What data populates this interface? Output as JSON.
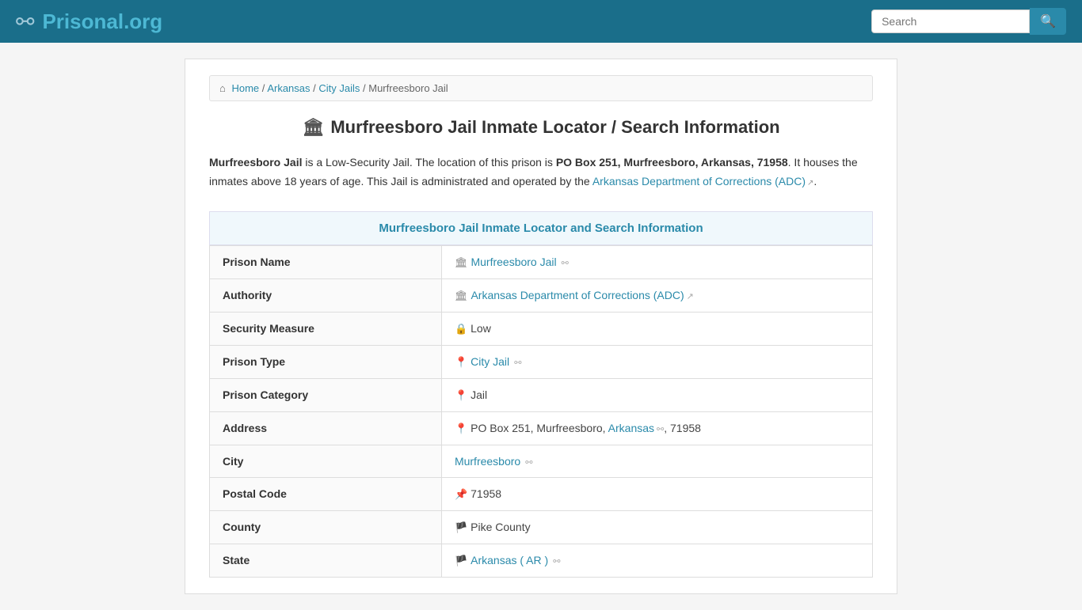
{
  "header": {
    "logo_text": "Prisonal",
    "logo_tld": ".org",
    "search_placeholder": "Search"
  },
  "breadcrumb": {
    "items": [
      {
        "label": "Home",
        "href": "#",
        "icon": "home"
      },
      {
        "label": "Arkansas",
        "href": "#"
      },
      {
        "label": "City Jails",
        "href": "#"
      },
      {
        "label": "Murfreesboro Jail",
        "href": null
      }
    ]
  },
  "page": {
    "title": "Murfreesboro Jail Inmate Locator / Search Information",
    "description_parts": {
      "jail_name": "Murfreesboro Jail",
      "intro": " is a Low-Security Jail. The location of this prison is ",
      "address_bold": "PO Box 251, Murfreesboro, Arkansas, 71958",
      "mid": ". It houses the inmates above 18 years of age. This Jail is administrated and operated by the ",
      "authority_link": "Arkansas Department of Corrections (ADC)",
      "end": "."
    },
    "section_header": "Murfreesboro Jail Inmate Locator and Search Information",
    "table": [
      {
        "label": "Prison Name",
        "icon": "🏛",
        "value": "Murfreesboro Jail",
        "link": true
      },
      {
        "label": "Authority",
        "icon": "🏛",
        "value": "Arkansas Department of Corrections (ADC)",
        "link": true,
        "ext": true
      },
      {
        "label": "Security Measure",
        "icon": "🔒",
        "value": "Low",
        "link": false
      },
      {
        "label": "Prison Type",
        "icon": "📍",
        "value": "City Jail",
        "link": true,
        "ext": true
      },
      {
        "label": "Prison Category",
        "icon": "📍",
        "value": "Jail",
        "link": false
      },
      {
        "label": "Address",
        "icon": "📍",
        "value": "PO Box 251, Murfreesboro, Arkansas",
        "value_extra": ", 71958",
        "link_part": "Arkansas",
        "link": true,
        "mixed": true
      },
      {
        "label": "City",
        "icon": "",
        "value": "Murfreesboro",
        "link": true
      },
      {
        "label": "Postal Code",
        "icon": "📌",
        "value": "71958",
        "link": false
      },
      {
        "label": "County",
        "icon": "🏴",
        "value": "Pike County",
        "link": false
      },
      {
        "label": "State",
        "icon": "🏴",
        "value": "Arkansas ( AR )",
        "link": true,
        "ext": true
      }
    ]
  }
}
